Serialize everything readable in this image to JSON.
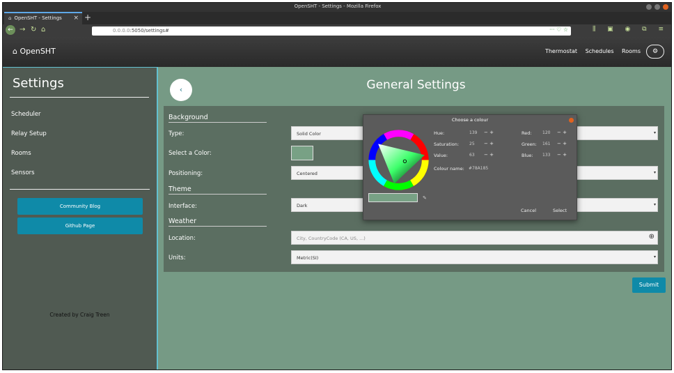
{
  "window": {
    "title": "OpenSHT - Settings - Mozilla Firefox",
    "tab_title": "OpenSHT - Settings",
    "url_host": "0.0.0.0",
    "url_path": ":5050/settings#"
  },
  "navbar": {
    "brand": "OpenSHT",
    "links": [
      "Thermostat",
      "Schedules",
      "Rooms"
    ]
  },
  "sidebar": {
    "title": "Settings",
    "items": [
      "Scheduler",
      "Relay Setup",
      "Rooms",
      "Sensors"
    ],
    "buttons": [
      "Community Blog",
      "Github Page"
    ],
    "credit": "Created by Craig Treen"
  },
  "main": {
    "title": "General Settings",
    "sections": {
      "background": "Background",
      "theme": "Theme",
      "weather": "Weather"
    },
    "labels": {
      "type": "Type:",
      "select_color": "Select a Color:",
      "positioning": "Positioning:",
      "interface": "Interface:",
      "location": "Location:",
      "units": "Units:"
    },
    "values": {
      "type": "Solid Color",
      "positioning": "Centered",
      "interface": "Dark",
      "location_placeholder": "City, CountryCode (CA, US, ...)",
      "units": "Metric(SI)",
      "selected_color": "#78A185"
    },
    "submit": "Submit"
  },
  "dialog": {
    "title": "Choose a colour",
    "hue_label": "Hue:",
    "hue": "139",
    "saturation_label": "Saturation:",
    "saturation": "25",
    "value_label": "Value:",
    "value": "63",
    "red_label": "Red:",
    "red": "120",
    "green_label": "Green:",
    "green": "161",
    "blue_label": "Blue:",
    "blue": "133",
    "colour_name_label": "Colour name:",
    "colour_name": "#78A185",
    "cancel": "Cancel",
    "select": "Select"
  },
  "icons": {
    "home": "home-icon",
    "gear": "gears-icon",
    "back": "chevron-left-icon",
    "search": "zoom-icon"
  },
  "colors": {
    "accent": "#0f8aa8",
    "sidebar": "#505a52",
    "background": "#769a85",
    "panel": "#5b6e61"
  }
}
